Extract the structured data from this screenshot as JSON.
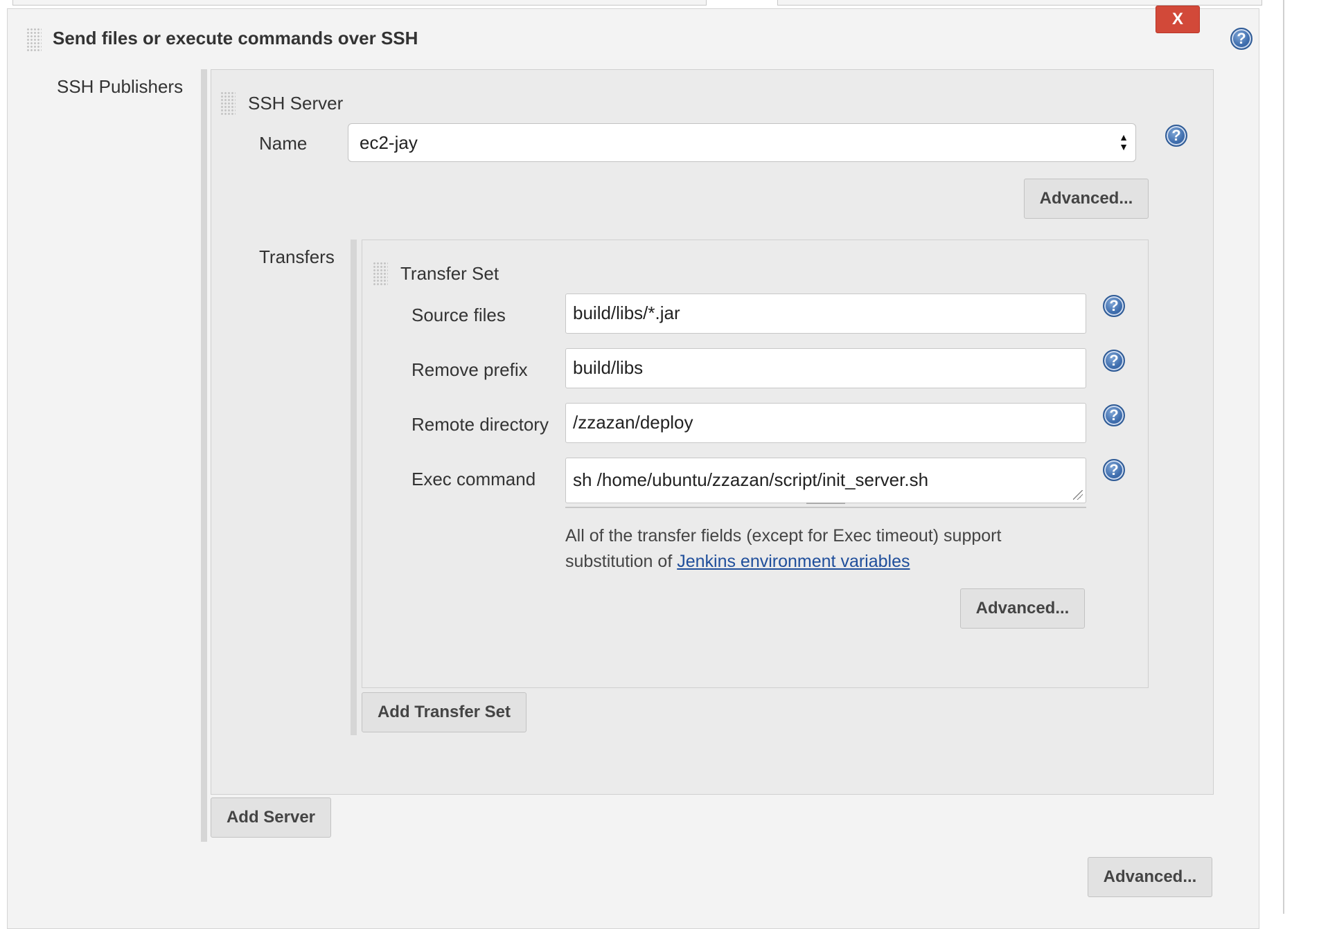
{
  "section": {
    "title": "Send files or execute commands over SSH",
    "close_label": "X",
    "help_label": "?"
  },
  "ssh_publishers": {
    "label": "SSH Publishers",
    "server": {
      "title": "SSH Server",
      "name_label": "Name",
      "name_value": "ec2-jay",
      "advanced_label": "Advanced..."
    },
    "transfers": {
      "label": "Transfers",
      "set": {
        "title": "Transfer Set",
        "fields": [
          {
            "label": "Source files",
            "value": "build/libs/*.jar"
          },
          {
            "label": "Remove prefix",
            "value": "build/libs"
          },
          {
            "label": "Remote directory",
            "value": "/zzazan/deploy"
          },
          {
            "label": "Exec command",
            "value": "sh /home/ubuntu/zzazan/script/init_server.sh"
          }
        ],
        "note_text": "All of the transfer fields (except for Exec timeout) support",
        "note_text2": "substitution of",
        "note_link": "Jenkins environment variables",
        "advanced_label": "Advanced..."
      },
      "add_transfer_set_label": "Add Transfer Set"
    },
    "add_server_label": "Add Server"
  },
  "footer": {
    "advanced_label": "Advanced..."
  }
}
